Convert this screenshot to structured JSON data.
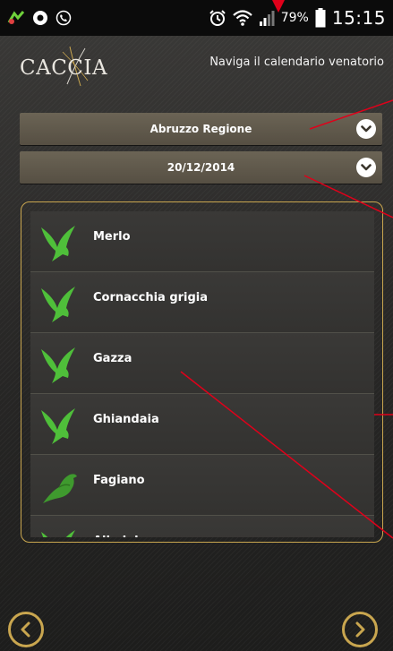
{
  "status_bar": {
    "battery_percent": "79%",
    "time": "15:15",
    "icons": [
      "app-notification-icon",
      "chrome-icon",
      "call-icon",
      "alarm-icon",
      "wifi-icon",
      "signal-icon",
      "battery-icon"
    ]
  },
  "header": {
    "logo_text": "CACCIA",
    "caption": "Naviga il calendario venatorio"
  },
  "region_select": {
    "value": "Abruzzo Regione"
  },
  "date_select": {
    "value": "20/12/2014"
  },
  "species": [
    {
      "name": "Merlo",
      "icon": "swallow-icon"
    },
    {
      "name": "Cornacchia grigia",
      "icon": "swallow-icon"
    },
    {
      "name": "Gazza",
      "icon": "swallow-icon"
    },
    {
      "name": "Ghiandaia",
      "icon": "swallow-icon"
    },
    {
      "name": "Fagiano",
      "icon": "pheasant-icon"
    },
    {
      "name": "Allodola",
      "icon": "swallow-icon"
    }
  ],
  "colors": {
    "accent_gold": "#c9a64f",
    "bird_green": "#4fbf3a",
    "annotation_red": "#e0001a"
  }
}
